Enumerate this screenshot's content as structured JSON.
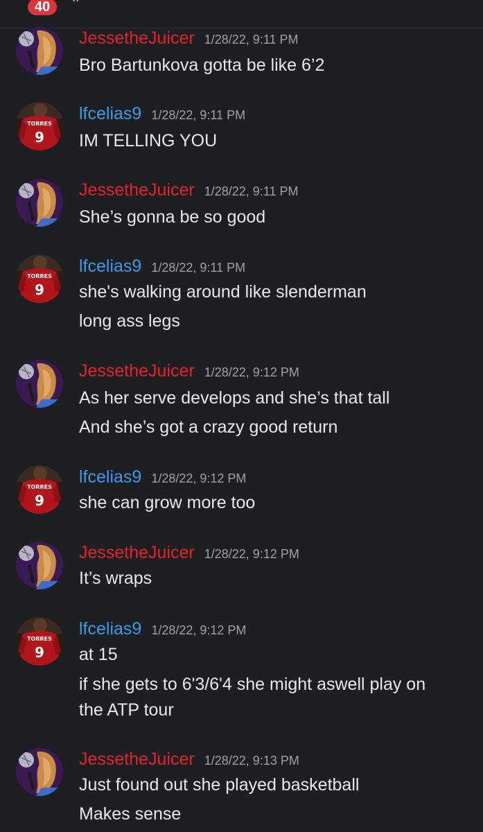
{
  "header": {
    "unread_badge": "40",
    "partial_mark": "”"
  },
  "colors": {
    "background": "#1e1f22",
    "jesse_name": "#e0252d",
    "lfc_name": "#3d9be8",
    "timestamp": "#9ea1a8",
    "message_text": "#e7e8ea",
    "badge": "#da373c"
  },
  "messages": [
    {
      "author": "JessetheJuicer",
      "timestamp": "1/28/22, 9:11 PM",
      "lines": [
        "Bro Bartunkova gotta be like 6’2"
      ]
    },
    {
      "author": "lfcelias9",
      "timestamp": "1/28/22, 9:11 PM",
      "lines": [
        "IM TELLING YOU"
      ]
    },
    {
      "author": "JessetheJuicer",
      "timestamp": "1/28/22, 9:11 PM",
      "lines": [
        "She’s gonna be so good"
      ]
    },
    {
      "author": "lfcelias9",
      "timestamp": "1/28/22, 9:11 PM",
      "lines": [
        "she's walking around like slenderman",
        "long ass legs"
      ]
    },
    {
      "author": "JessetheJuicer",
      "timestamp": "1/28/22, 9:12 PM",
      "lines": [
        "As her serve develops and she’s that tall",
        "And she’s got a crazy good return"
      ]
    },
    {
      "author": "lfcelias9",
      "timestamp": "1/28/22, 9:12 PM",
      "lines": [
        "she can grow more too"
      ]
    },
    {
      "author": "JessetheJuicer",
      "timestamp": "1/28/22, 9:12 PM",
      "lines": [
        "It’s wraps"
      ]
    },
    {
      "author": "lfcelias9",
      "timestamp": "1/28/22, 9:12 PM",
      "lines": [
        "at 15",
        "if she gets to 6'3/6'4 she might aswell play on",
        "the ATP tour"
      ]
    },
    {
      "author": "JessetheJuicer",
      "timestamp": "1/28/22, 9:13 PM",
      "lines": [
        "Just found out she played basketball",
        "Makes sense"
      ]
    }
  ]
}
